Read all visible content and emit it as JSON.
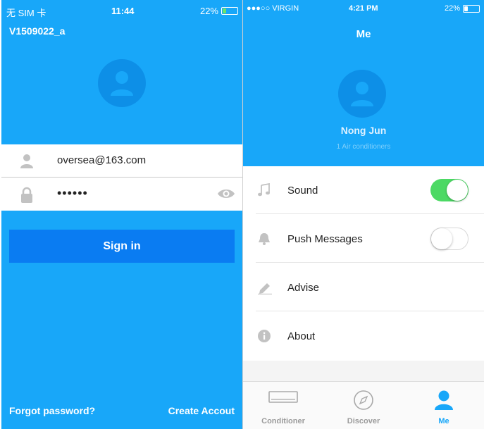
{
  "left": {
    "status": {
      "carrier": "无 SIM 卡",
      "time": "11:44",
      "battery": "22%"
    },
    "device_title": "V1509022_a",
    "email_value": "oversea@163.com",
    "password_value": "••••••",
    "signin_label": "Sign in",
    "forgot_label": "Forgot password?",
    "create_label": "Create Accout"
  },
  "right": {
    "status": {
      "carrier": "VIRGIN",
      "time": "4:21 PM",
      "battery": "22%"
    },
    "page_title": "Me",
    "username": "Nong Jun",
    "subtitle": "1 Air conditioners",
    "menu": [
      {
        "label": "Sound",
        "icon": "music-note-icon",
        "toggle": true
      },
      {
        "label": "Push Messages",
        "icon": "bell-icon",
        "toggle": false
      },
      {
        "label": "Advise",
        "icon": "pencil-icon"
      },
      {
        "label": "About",
        "icon": "info-icon"
      }
    ],
    "tabs": [
      {
        "label": "Conditioner",
        "icon": "air-conditioner-icon"
      },
      {
        "label": "Discover",
        "icon": "compass-icon"
      },
      {
        "label": "Me",
        "icon": "person-icon",
        "active": true
      }
    ]
  },
  "colors": {
    "brand_blue": "#18a7f9",
    "button_blue": "#0a7cf2",
    "toggle_green": "#4cd964"
  }
}
